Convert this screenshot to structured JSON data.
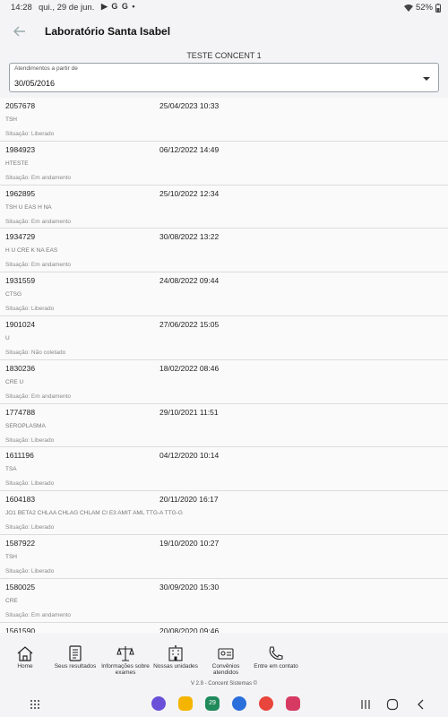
{
  "status_bar": {
    "time": "14:28",
    "date": "qui., 29 de jun.",
    "notifications": "▶ G G •",
    "battery": "52%"
  },
  "app_bar": {
    "title": "Laboratório Santa Isabel"
  },
  "subtitle": "TESTE CONCENT 1",
  "filter": {
    "label": "Atendimentos a partir de",
    "value": "30/05/2016"
  },
  "situation_label": "Situação:",
  "attendances": [
    {
      "code": "2057678",
      "datetime": "25/04/2023 10:33",
      "exams": "TSH",
      "status": "Liberado"
    },
    {
      "code": "1984923",
      "datetime": "06/12/2022 14:49",
      "exams": "HTESTE",
      "status": "Em andamento"
    },
    {
      "code": "1962895",
      "datetime": "25/10/2022 12:34",
      "exams": "TSH U EAS H NA",
      "status": "Em andamento"
    },
    {
      "code": "1934729",
      "datetime": "30/08/2022 13:22",
      "exams": "H U CRE K NA EAS",
      "status": "Em andamento"
    },
    {
      "code": "1931559",
      "datetime": "24/08/2022 09:44",
      "exams": "CTSG",
      "status": "Liberado"
    },
    {
      "code": "1901024",
      "datetime": "27/06/2022 15:05",
      "exams": "U",
      "status": "Não coletado"
    },
    {
      "code": "1830236",
      "datetime": "18/02/2022 08:46",
      "exams": "CRE U",
      "status": "Em andamento"
    },
    {
      "code": "1774788",
      "datetime": "29/10/2021 11:51",
      "exams": "SEROPLASMA",
      "status": "Liberado"
    },
    {
      "code": "1611196",
      "datetime": "04/12/2020 10:14",
      "exams": "TSA",
      "status": "Liberado"
    },
    {
      "code": "1604183",
      "datetime": "20/11/2020 16:17",
      "exams": "JO1 BETA2 CHLAA CHLAG CHLAM CI E3 AMIT AML TTG-A TTG-G",
      "status": "Liberado"
    },
    {
      "code": "1587922",
      "datetime": "19/10/2020 10:27",
      "exams": "TSH",
      "status": "Liberado"
    },
    {
      "code": "1580025",
      "datetime": "30/09/2020 15:30",
      "exams": "CRE",
      "status": "Em andamento"
    },
    {
      "code": "1561590",
      "datetime": "20/08/2020 09:46",
      "exams": "",
      "status": ""
    }
  ],
  "bottom_nav": [
    {
      "label": "Home",
      "icon": "home-icon"
    },
    {
      "label": "Seus resultados",
      "icon": "results-icon"
    },
    {
      "label": "Informações sobre exames",
      "icon": "exam-info-icon"
    },
    {
      "label": "Nossas unidades",
      "icon": "building-icon"
    },
    {
      "label": "Convênios atendidos",
      "icon": "card-icon"
    },
    {
      "label": "Entre em contato",
      "icon": "phone-icon"
    }
  ],
  "version": "V 2.9 - Concent Sistemas ©",
  "system_nav": {
    "apps": [
      "internet-icon",
      "folder-icon",
      "calendar-icon",
      "messages-icon",
      "assistant-icon",
      "camera-icon"
    ],
    "calendar_day": "29"
  },
  "colors": {
    "background": "#f4f4f6",
    "list_background": "#fafafb",
    "divider": "#dcdcdf"
  }
}
